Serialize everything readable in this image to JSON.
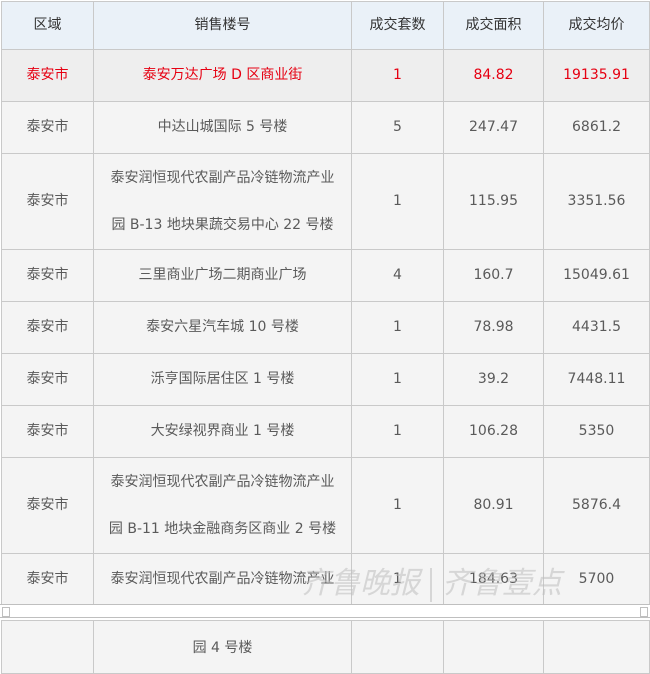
{
  "table": {
    "headers": [
      "区域",
      "销售楼号",
      "成交套数",
      "成交面积",
      "成交均价"
    ],
    "rows": [
      {
        "region": "泰安市",
        "building": "泰安万达广场 D 区商业街",
        "units": "1",
        "area": "84.82",
        "price": "19135.91"
      },
      {
        "region": "泰安市",
        "building": "中达山城国际 5 号楼",
        "units": "5",
        "area": "247.47",
        "price": "6861.2"
      },
      {
        "region": "泰安市",
        "building_line1": "泰安润恒现代农副产品冷链物流产业",
        "building_line2": "园 B-13 地块果蔬交易中心 22 号楼",
        "units": "1",
        "area": "115.95",
        "price": "3351.56"
      },
      {
        "region": "泰安市",
        "building": "三里商业广场二期商业广场",
        "units": "4",
        "area": "160.7",
        "price": "15049.61"
      },
      {
        "region": "泰安市",
        "building": "泰安六星汽车城 10 号楼",
        "units": "1",
        "area": "78.98",
        "price": "4431.5"
      },
      {
        "region": "泰安市",
        "building": "泺亨国际居住区 1 号楼",
        "units": "1",
        "area": "39.2",
        "price": "7448.11"
      },
      {
        "region": "泰安市",
        "building": "大安绿视界商业 1 号楼",
        "units": "1",
        "area": "106.28",
        "price": "5350"
      },
      {
        "region": "泰安市",
        "building_line1": "泰安润恒现代农副产品冷链物流产业",
        "building_line2": "园 B-11 地块金融商务区商业 2 号楼",
        "units": "1",
        "area": "80.91",
        "price": "5876.4"
      },
      {
        "region": "泰安市",
        "building": "泰安润恒现代农副产品冷链物流产业",
        "units": "1",
        "area": "184.63",
        "price": "5700"
      }
    ],
    "continuation": {
      "building": "园 4 号楼"
    }
  },
  "highlight_color": "#e60012",
  "watermark": {
    "text": "齐鲁晚报",
    "brand": "齐鲁壹点"
  }
}
